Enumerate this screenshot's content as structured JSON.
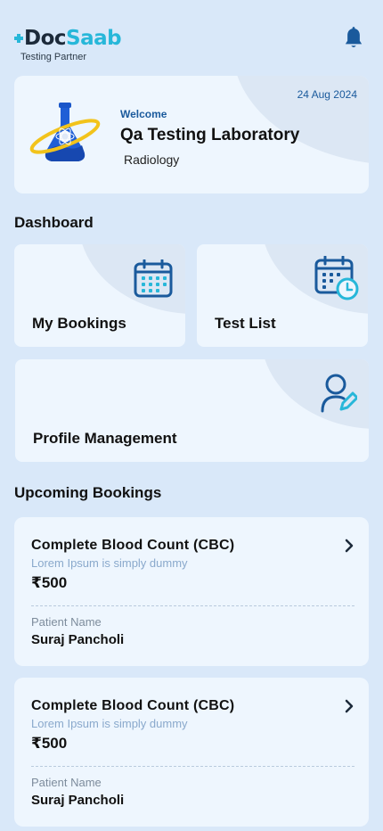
{
  "brand": {
    "name_part1": "Doc",
    "name_part2": "Saab",
    "tagline": "Testing Partner"
  },
  "welcome": {
    "greeting": "Welcome",
    "lab_name": "Qa Testing Laboratory",
    "lab_type": "Radiology",
    "date": "24 Aug 2024"
  },
  "dashboard": {
    "title": "Dashboard",
    "tiles": [
      {
        "label": "My Bookings",
        "icon": "calendar-icon"
      },
      {
        "label": "Test List",
        "icon": "calendar-clock-icon"
      },
      {
        "label": "Profile Management",
        "icon": "user-edit-icon"
      }
    ]
  },
  "upcoming": {
    "title": "Upcoming Bookings",
    "bookings": [
      {
        "test_name": "Complete Blood Count (CBC)",
        "description": "Lorem Ipsum is simply dummy",
        "price": "₹500",
        "patient_label": "Patient Name",
        "patient_name": "Suraj Pancholi"
      },
      {
        "test_name": "Complete Blood Count (CBC)",
        "description": "Lorem Ipsum is simply dummy",
        "price": "₹500",
        "patient_label": "Patient Name",
        "patient_name": "Suraj Pancholi"
      }
    ]
  },
  "colors": {
    "accent": "#27b7d9",
    "primary": "#1a5a9c",
    "background": "#d9e8f9",
    "card": "#eef6fe"
  }
}
